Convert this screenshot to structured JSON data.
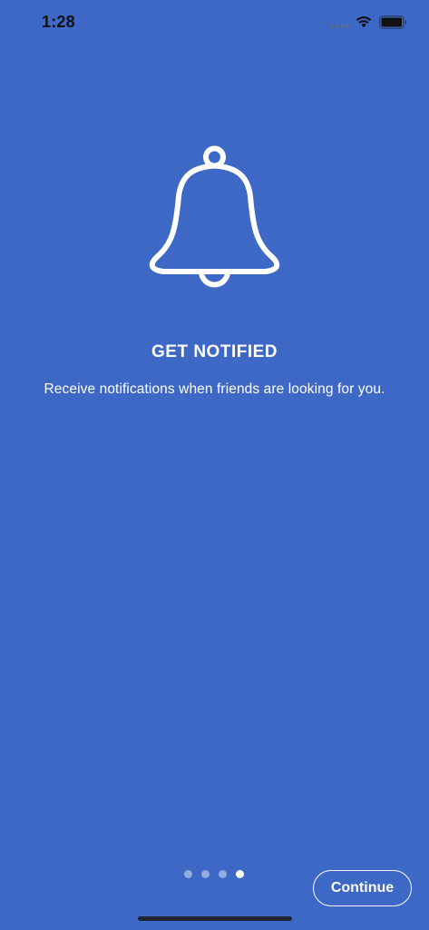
{
  "status_bar": {
    "time": "1:28"
  },
  "onboarding": {
    "icon": "bell-icon",
    "title": "GET NOTIFIED",
    "description": "Receive notifications when friends are looking for you."
  },
  "pager": {
    "total_pages": 4,
    "current_page": 4
  },
  "actions": {
    "continue_label": "Continue"
  },
  "colors": {
    "background": "#3d68c6",
    "foreground": "#ffffff"
  }
}
